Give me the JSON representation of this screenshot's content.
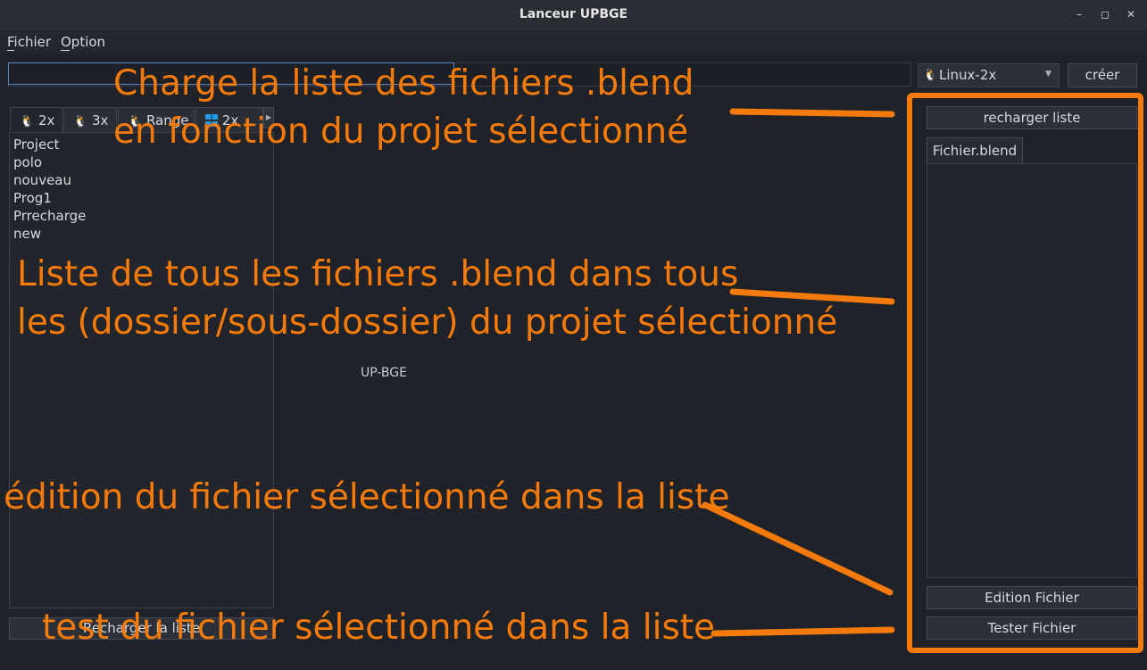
{
  "window": {
    "title": "Lanceur UPBGE",
    "controls": [
      "minimize",
      "maximize",
      "close"
    ]
  },
  "menubar": {
    "items": [
      {
        "label": "Fichier"
      },
      {
        "label": "Option"
      }
    ]
  },
  "toolbar": {
    "path_value": "",
    "version_selected": "Linux-2x",
    "create_label": "créer"
  },
  "tabs": [
    {
      "label": "2x",
      "icon": "linux-icon"
    },
    {
      "label": "3x",
      "icon": "linux-icon"
    },
    {
      "label": "Range",
      "icon": "linux-icon"
    },
    {
      "label": "2x",
      "icon": "windows-icon"
    }
  ],
  "projects": [
    "Project",
    "polo",
    "nouveau",
    "Prog1",
    "Prrecharge",
    "new"
  ],
  "left": {
    "reload_label": "Recharger la liste"
  },
  "center": {
    "label": "UP-BGE"
  },
  "right": {
    "reload_label": "recharger liste",
    "file_tab_label": "Fichier.blend",
    "edit_label": "Edition Fichier",
    "test_label": "Tester Fichier"
  },
  "annotations": {
    "charge_line1": "Charge la liste des fichiers .blend",
    "charge_line2": "en fonction du projet sélectionné",
    "liste_line1": "Liste de tous les fichiers .blend dans tous",
    "liste_line2": "les (dossier/sous-dossier) du projet sélectionné",
    "edition": "édition du fichier sélectionné dans la liste",
    "test": "test du fichier sélectionné dans la liste",
    "color": "#f47a0c"
  },
  "colors": {
    "background": "#1f2229",
    "accent": "#5a87c9"
  }
}
